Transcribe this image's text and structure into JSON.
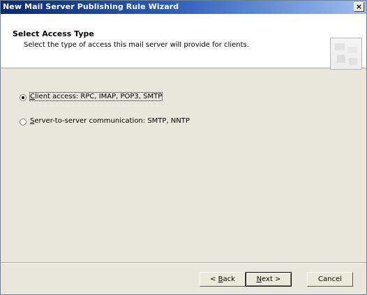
{
  "window": {
    "title": "New Mail Server Publishing Rule Wizard",
    "close_label": "×"
  },
  "header": {
    "title": "Select Access Type",
    "subtitle": "Select the type of access this mail server will provide for clients."
  },
  "options": [
    {
      "mnemonic": "C",
      "label_rest": "lient access: RPC, IMAP, POP3, SMTP",
      "full_label": "Client access: RPC, IMAP, POP3, SMTP",
      "selected": true
    },
    {
      "mnemonic": "S",
      "label_rest": "erver-to-server communication: SMTP, NNTP",
      "full_label": "Server-to-server communication: SMTP, NNTP",
      "selected": false
    }
  ],
  "buttons": {
    "back": {
      "prefix": "< ",
      "mnemonic": "B",
      "rest": "ack"
    },
    "next": {
      "prefix": "",
      "mnemonic": "N",
      "rest": "ext >"
    },
    "cancel": {
      "label": "Cancel"
    }
  }
}
